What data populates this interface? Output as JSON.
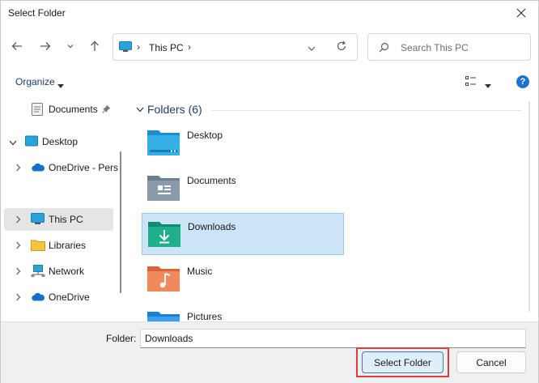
{
  "window": {
    "title": "Select Folder"
  },
  "navbar": {
    "address": {
      "location_icon": "this-pc-icon",
      "path": "This PC"
    },
    "search": {
      "placeholder": "Search This PC"
    }
  },
  "commandbar": {
    "organize_label": "Organize",
    "help_label": "?"
  },
  "sidebar": {
    "items": [
      {
        "label": "Documents",
        "icon": "documents-icon",
        "pinned": true
      },
      {
        "label": "Desktop",
        "icon": "desktop-icon",
        "expanded": true
      },
      {
        "label": "OneDrive - Pers",
        "icon": "onedrive-icon"
      },
      {
        "label": "This PC",
        "icon": "this-pc-icon",
        "selected": true
      },
      {
        "label": "Libraries",
        "icon": "libraries-icon"
      },
      {
        "label": "Network",
        "icon": "network-icon"
      },
      {
        "label": "OneDrive",
        "icon": "onedrive-icon"
      }
    ]
  },
  "content": {
    "group": {
      "label": "Folders (6)"
    },
    "folders": [
      {
        "label": "Desktop",
        "icon": "desktop-folder-icon"
      },
      {
        "label": "Documents",
        "icon": "documents-folder-icon"
      },
      {
        "label": "Downloads",
        "icon": "downloads-folder-icon",
        "selected": true
      },
      {
        "label": "Music",
        "icon": "music-folder-icon"
      },
      {
        "label": "Pictures",
        "icon": "pictures-folder-icon"
      }
    ]
  },
  "footer": {
    "folder_label": "Folder:",
    "folder_value": "Downloads",
    "select_button": "Select Folder",
    "cancel_button": "Cancel"
  },
  "colors": {
    "accent": "#1e73d2",
    "selection": "#cce4f7",
    "highlight": "#e23b3b"
  }
}
